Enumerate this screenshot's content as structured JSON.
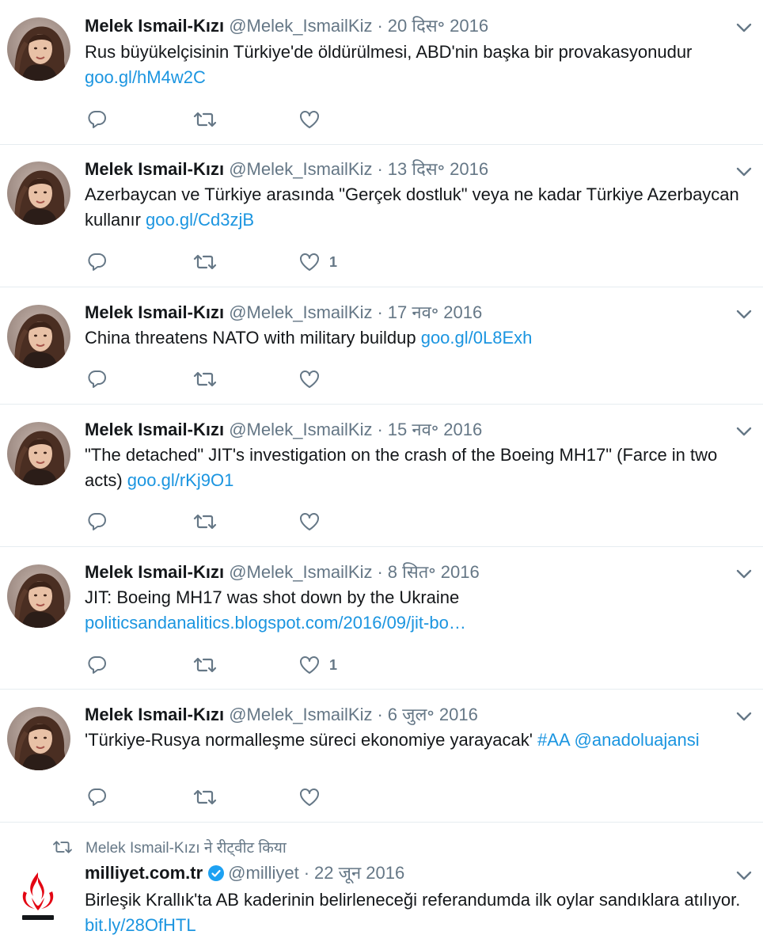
{
  "tweets": [
    {
      "name": "Melek Ismail-Kızı",
      "handle": "@Melek_IsmailKiz",
      "date": "20 दिस॰ 2016",
      "text": "Rus büyükelçisinin Türkiye'de öldürülmesi, ABD'nin başka bir provakasyonudur ",
      "link": "goo.gl/hM4w2C",
      "likes": ""
    },
    {
      "name": "Melek Ismail-Kızı",
      "handle": "@Melek_IsmailKiz",
      "date": "13 दिस॰ 2016",
      "text": "Azerbaycan ve Türkiye arasında \"Gerçek dostluk\" veya ne kadar Türkiye Azerbaycan kullanır ",
      "link": "goo.gl/Cd3zjB",
      "likes": "1"
    },
    {
      "name": "Melek Ismail-Kızı",
      "handle": "@Melek_IsmailKiz",
      "date": "17 नव॰ 2016",
      "text": "China threatens NATO with military buildup ",
      "link": "goo.gl/0L8Exh",
      "likes": ""
    },
    {
      "name": "Melek Ismail-Kızı",
      "handle": "@Melek_IsmailKiz",
      "date": "15 नव॰ 2016",
      "text": "\"The detached\" JIT's investigation on the crash of the Boeing MH17\" (Farce in two acts) ",
      "link": "goo.gl/rKj9O1",
      "likes": ""
    },
    {
      "name": "Melek Ismail-Kızı",
      "handle": "@Melek_IsmailKiz",
      "date": "8 सित॰ 2016",
      "text": "JIT: Boeing MH17 was shot down by the Ukraine ",
      "link": "politicsandanalitics.blogspot.com/2016/09/jit-bo…",
      "likes": "1"
    },
    {
      "name": "Melek Ismail-Kızı",
      "handle": "@Melek_IsmailKiz",
      "date": "6 जुल॰ 2016",
      "text": "'Türkiye-Rusya normalleşme süreci ekonomiye yarayacak' ",
      "link": "#AA",
      "link2": "@anadoluajansi",
      "likes": ""
    }
  ],
  "retweet": {
    "context": "Melek Ismail-Kızı ने रीट्वीट किया",
    "name": "milliyet.com.tr",
    "handle": "@milliyet",
    "date": "22 जून 2016",
    "text": "Birleşik Krallık'ta AB kaderinin belirleneceği referandumda ilk oylar sandıklara atılıyor. ",
    "link": "bit.ly/28OfHTL"
  },
  "icons": {
    "reply": "reply-icon",
    "retweet": "retweet-icon",
    "like": "heart-icon",
    "more": "chevron-down-icon",
    "verified": "verified-badge-icon"
  },
  "colors": {
    "link": "#1b95e0",
    "muted": "#657786",
    "text": "#14171a",
    "verified": "#1da1f2",
    "milliyet_red": "#e30613"
  },
  "separator": "·"
}
